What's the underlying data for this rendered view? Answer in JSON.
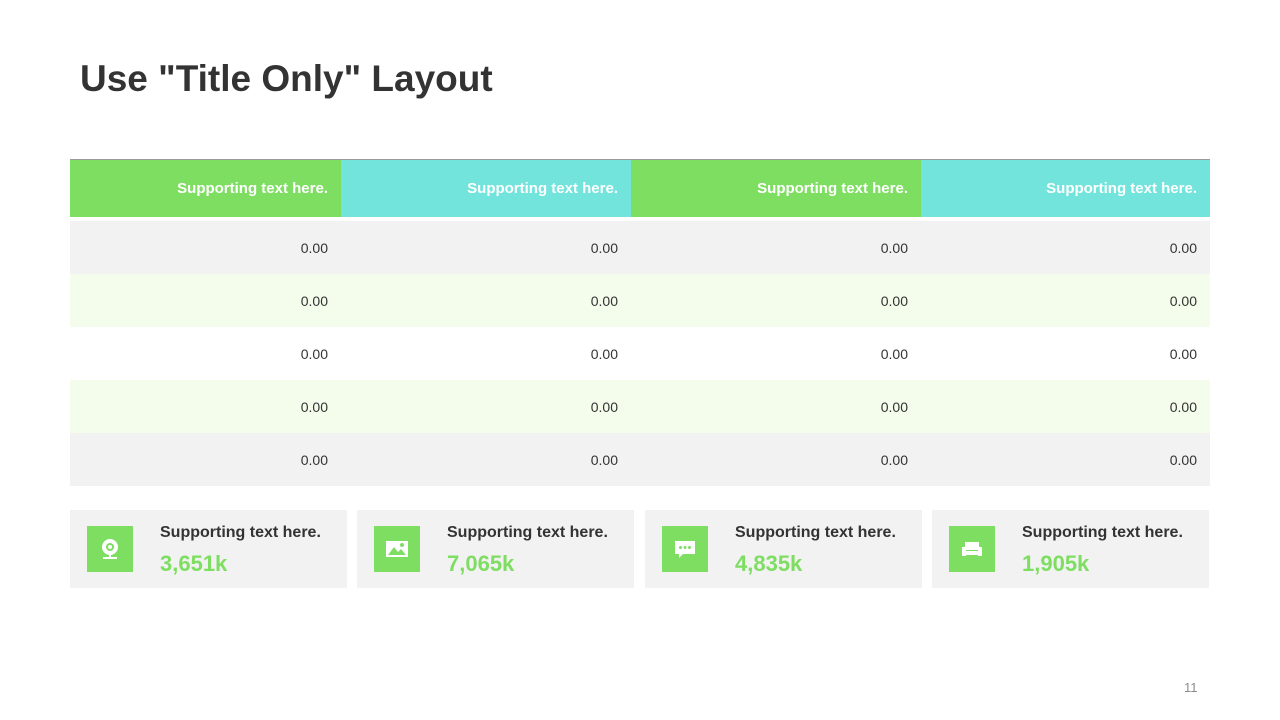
{
  "title": "Use \"Title Only\" Layout",
  "colors": {
    "accent_green": "#7ede62",
    "accent_cyan": "#72e4dc",
    "row_gray": "#f2f2f2",
    "row_light_green": "#f4fdeb",
    "text_dark": "#333333"
  },
  "table": {
    "headers": [
      "Supporting text here.",
      "Supporting text here.",
      "Supporting text here.",
      "Supporting text here."
    ],
    "rows": [
      [
        "0.00",
        "0.00",
        "0.00",
        "0.00"
      ],
      [
        "0.00",
        "0.00",
        "0.00",
        "0.00"
      ],
      [
        "0.00",
        "0.00",
        "0.00",
        "0.00"
      ],
      [
        "0.00",
        "0.00",
        "0.00",
        "0.00"
      ],
      [
        "0.00",
        "0.00",
        "0.00",
        "0.00"
      ]
    ]
  },
  "stats": [
    {
      "icon": "webcam-icon",
      "label": "Supporting text here.",
      "value": "3,651k"
    },
    {
      "icon": "image-icon",
      "label": "Supporting text here.",
      "value": "7,065k"
    },
    {
      "icon": "chat-icon",
      "label": "Supporting text here.",
      "value": "4,835k"
    },
    {
      "icon": "sofa-icon",
      "label": "Supporting text here.",
      "value": "1,905k"
    }
  ],
  "page_number": "11"
}
